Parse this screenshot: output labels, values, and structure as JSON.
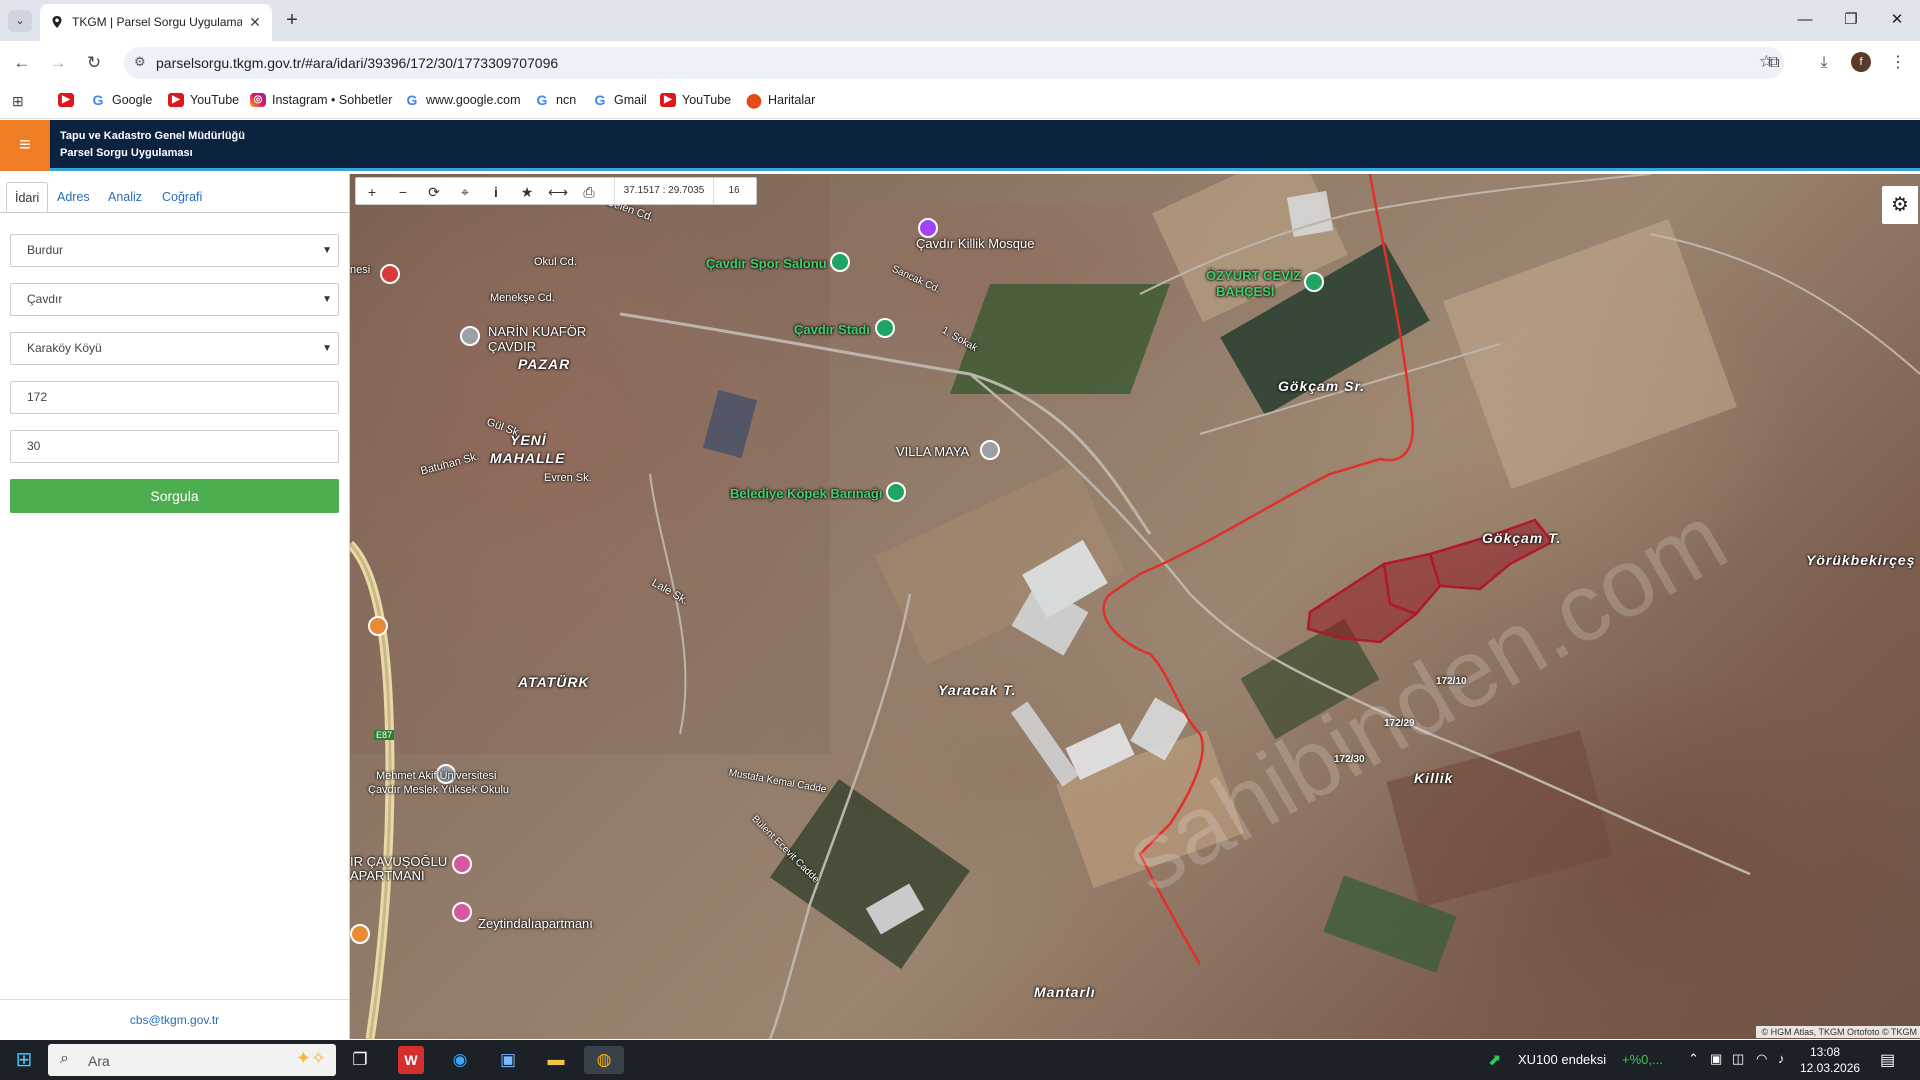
{
  "browser": {
    "tab_title": "TKGM | Parsel Sorgu Uygulaması",
    "url": "parselsorgu.tkgm.gov.tr/#ara/idari/39396/172/30/1773309707096",
    "profile_letter": "f"
  },
  "bookmarks": [
    {
      "label": "",
      "icon": "youtube-icon"
    },
    {
      "label": "Google",
      "icon": "google-icon"
    },
    {
      "label": "YouTube",
      "icon": "youtube-icon"
    },
    {
      "label": "Instagram • Sohbetler",
      "icon": "instagram-icon"
    },
    {
      "label": "www.google.com",
      "icon": "google-icon"
    },
    {
      "label": "ncn",
      "icon": "google-icon"
    },
    {
      "label": "Gmail",
      "icon": "google-icon"
    },
    {
      "label": "YouTube",
      "icon": "youtube-icon"
    },
    {
      "label": "Haritalar",
      "icon": "maps-icon"
    }
  ],
  "header": {
    "line1": "Tapu ve Kadastro Genel Müdürlüğü",
    "line2": "Parsel Sorgu Uygulaması"
  },
  "panel": {
    "tabs": [
      "İdari",
      "Adres",
      "Analiz",
      "Coğrafi"
    ],
    "province": "Burdur",
    "district": "Çavdır",
    "neighborhood": "Karaköy Köyü",
    "block": "172",
    "parcel": "30",
    "submit": "Sorgula",
    "contact": "cbs@tkgm.gov.tr"
  },
  "map": {
    "coordinates": "37.1517 : 29.7035",
    "zoom": "16",
    "attribution": "© HGM Atlas, TKGM Ortofoto © TKGM",
    "watermark": "sahibinden.com",
    "labels": {
      "mosque": "Çavdır Killik Mosque",
      "spor": "Çavdır Spor Salonu",
      "stad": "Çavdır Stadı",
      "ceviz1": "ÖZYURT CEVİZ",
      "ceviz2": "BAHÇESİ",
      "narin1": "NARİN KUAFÖR",
      "narin2": "ÇAVDIR",
      "pazar": "PAZAR",
      "yeni": "YENİ",
      "mahalle": "MAHALLE",
      "villa": "VILLA MAYA",
      "barinak": "Belediye Köpek Barınağı",
      "gokcam_sr": "Gökçam Sr.",
      "gokcam_t": "Gökçam T.",
      "yorukbekir": "Yörükbekirçeş",
      "yaracak": "Yaracak T.",
      "killik": "Killik",
      "mantarli": "Mantarlı",
      "ataturk": "ATATÜRK",
      "univ1": "Mehmet Akif Üniversitesi",
      "univ2": "Çavdır Meslek Yüksek Okulu",
      "apart1": "IR ÇAVUŞOĞLU",
      "apart2": "APARTMANI",
      "zeytin": "Zeytindalıapartmanı",
      "belen": "Belen Cd.",
      "okul": "Okul Cd.",
      "menekse": "Menekşe Cd.",
      "evren": "Evren Sk.",
      "batuhan": "Batuhan Sk.",
      "gul": "Gül Sk.",
      "lale": "Lale Sk.",
      "mustafa": "Mustafa Kemal Cadde",
      "bulent": "Bülent Ecevit Cadde",
      "e87": "E87",
      "nesi": "nesi",
      "sancak": "Sancak Cd.",
      "sokak1": "1. Sokak"
    },
    "parcels": [
      "172/10",
      "172/29",
      "172/30"
    ]
  },
  "taskbar": {
    "search": "Ara",
    "stock_name": "XU100 endeksi",
    "stock_change": "+%0,...",
    "time": "13:08",
    "date": "12.03.2026"
  }
}
